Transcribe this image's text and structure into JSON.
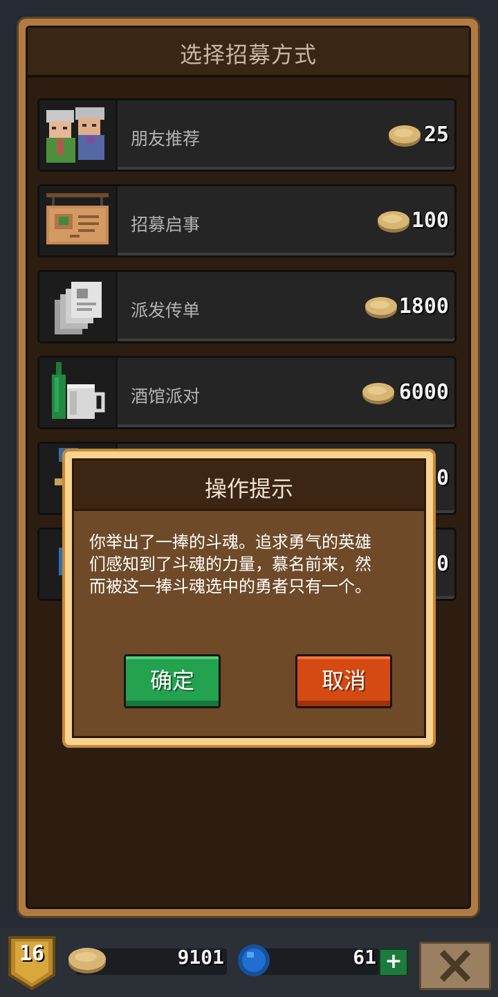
{
  "panel": {
    "title": "选择招募方式"
  },
  "options": [
    {
      "label": "朋友推荐",
      "price": "25",
      "icon": "friends-icon"
    },
    {
      "label": "招募启事",
      "price": "100",
      "icon": "notice-board-icon"
    },
    {
      "label": "派发传单",
      "price": "1800",
      "icon": "flyers-icon"
    },
    {
      "label": "酒馆派对",
      "price": "6000",
      "icon": "tavern-party-icon"
    }
  ],
  "hidden_options": [
    {
      "price_fragment": "0"
    },
    {
      "price_fragment": "0"
    }
  ],
  "dialog": {
    "title": "操作提示",
    "message_line1": "你举出了一捧的斗魂。追求勇气的英雄",
    "message_line2": "们感知到了斗魂的力量，慕名前来，然",
    "message_line3": "而被这一捧斗魂选中的勇者只有一个。",
    "confirm_label": "确定",
    "cancel_label": "取消"
  },
  "bottom_bar": {
    "level": "16",
    "gold": "9101",
    "gems": "61",
    "plus_label": "+"
  },
  "colors": {
    "confirm": "#23a34f",
    "cancel": "#d44a12",
    "coin": "#d8b573",
    "gem": "#1f6fd1"
  }
}
